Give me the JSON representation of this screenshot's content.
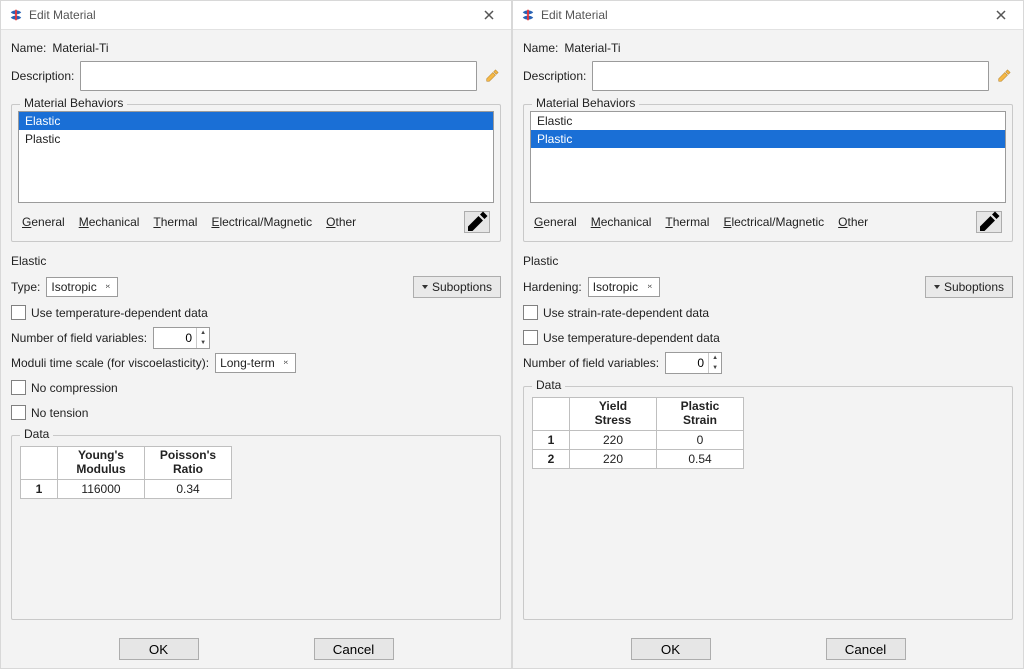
{
  "appIcon": "abaqus-logo",
  "dialogs": [
    {
      "title": "Edit Material",
      "nameLabel": "Name:",
      "nameValue": "Material-Ti",
      "descLabel": "Description:",
      "descValue": "",
      "behaviorsLegend": "Material Behaviors",
      "behaviors": [
        {
          "label": "Elastic",
          "selected": true
        },
        {
          "label": "Plastic",
          "selected": false
        }
      ],
      "menus": [
        "General",
        "Mechanical",
        "Thermal",
        "Electrical/Magnetic",
        "Other"
      ],
      "section": "Elastic",
      "fields": [
        {
          "kind": "combo",
          "label": "Type:",
          "value": "Isotropic",
          "suboptions": true,
          "suboptionsLabel": "Suboptions"
        },
        {
          "kind": "check",
          "label": "Use temperature-dependent data",
          "checked": false
        },
        {
          "kind": "spin",
          "label": "Number of field variables:",
          "value": "0"
        },
        {
          "kind": "combo",
          "label": "Moduli time scale (for viscoelasticity):",
          "value": "Long-term"
        },
        {
          "kind": "check",
          "label": "No compression",
          "checked": false
        },
        {
          "kind": "check",
          "label": "No tension",
          "checked": false
        }
      ],
      "dataLegend": "Data",
      "table": {
        "headers": [
          "Young's\nModulus",
          "Poisson's\nRatio"
        ],
        "rows": [
          [
            "116000",
            "0.34"
          ]
        ]
      },
      "ok": "OK",
      "cancel": "Cancel"
    },
    {
      "title": "Edit Material",
      "nameLabel": "Name:",
      "nameValue": "Material-Ti",
      "descLabel": "Description:",
      "descValue": "",
      "behaviorsLegend": "Material Behaviors",
      "behaviors": [
        {
          "label": "Elastic",
          "selected": false
        },
        {
          "label": "Plastic",
          "selected": true
        }
      ],
      "menus": [
        "General",
        "Mechanical",
        "Thermal",
        "Electrical/Magnetic",
        "Other"
      ],
      "section": "Plastic",
      "fields": [
        {
          "kind": "combo",
          "label": "Hardening:",
          "value": "Isotropic",
          "suboptions": true,
          "suboptionsLabel": "Suboptions"
        },
        {
          "kind": "check",
          "label": "Use strain-rate-dependent data",
          "checked": false
        },
        {
          "kind": "check",
          "label": "Use temperature-dependent data",
          "checked": false
        },
        {
          "kind": "spin",
          "label": "Number of field variables:",
          "value": "0"
        }
      ],
      "dataLegend": "Data",
      "table": {
        "headers": [
          "Yield\nStress",
          "Plastic\nStrain"
        ],
        "rows": [
          [
            "220",
            "0"
          ],
          [
            "220",
            "0.54"
          ]
        ]
      },
      "ok": "OK",
      "cancel": "Cancel"
    }
  ]
}
